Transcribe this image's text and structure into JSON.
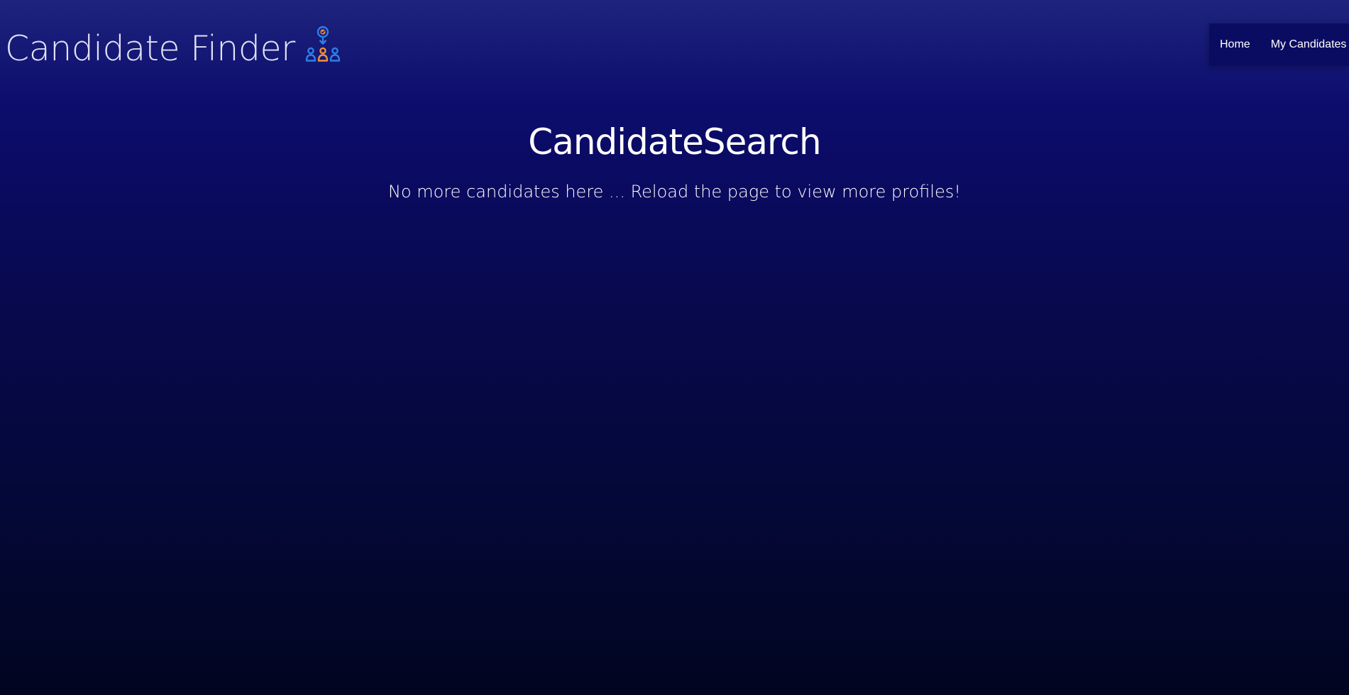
{
  "header": {
    "title": "Candidate Finder",
    "logo_icon": "candidate-selection-icon"
  },
  "nav": {
    "items": [
      {
        "label": "Home"
      },
      {
        "label": "My Candidates"
      }
    ]
  },
  "main": {
    "heading": "CandidateSearch",
    "message": "No more candidates here ... Reload the page to view more profiles!"
  },
  "colors": {
    "accent_blue": "#2f7fe8",
    "accent_orange": "#f0923a",
    "nav_background": "#0a0c62"
  }
}
